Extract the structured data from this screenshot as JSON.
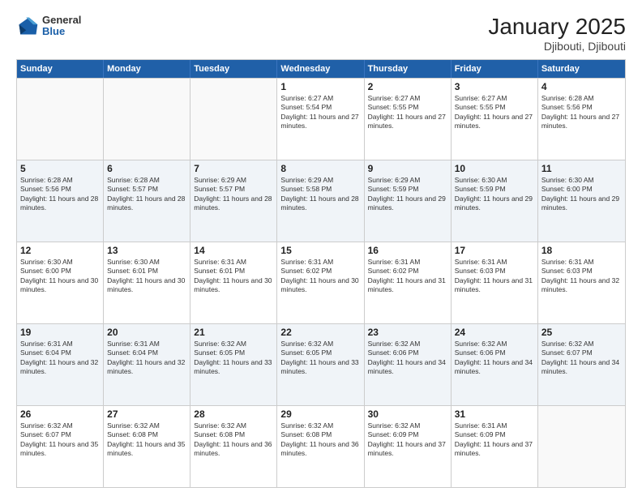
{
  "logo": {
    "general": "General",
    "blue": "Blue"
  },
  "header": {
    "title": "January 2025",
    "subtitle": "Djibouti, Djibouti"
  },
  "weekdays": [
    "Sunday",
    "Monday",
    "Tuesday",
    "Wednesday",
    "Thursday",
    "Friday",
    "Saturday"
  ],
  "weeks": [
    [
      {
        "day": "",
        "info": ""
      },
      {
        "day": "",
        "info": ""
      },
      {
        "day": "",
        "info": ""
      },
      {
        "day": "1",
        "info": "Sunrise: 6:27 AM\nSunset: 5:54 PM\nDaylight: 11 hours and 27 minutes."
      },
      {
        "day": "2",
        "info": "Sunrise: 6:27 AM\nSunset: 5:55 PM\nDaylight: 11 hours and 27 minutes."
      },
      {
        "day": "3",
        "info": "Sunrise: 6:27 AM\nSunset: 5:55 PM\nDaylight: 11 hours and 27 minutes."
      },
      {
        "day": "4",
        "info": "Sunrise: 6:28 AM\nSunset: 5:56 PM\nDaylight: 11 hours and 27 minutes."
      }
    ],
    [
      {
        "day": "5",
        "info": "Sunrise: 6:28 AM\nSunset: 5:56 PM\nDaylight: 11 hours and 28 minutes."
      },
      {
        "day": "6",
        "info": "Sunrise: 6:28 AM\nSunset: 5:57 PM\nDaylight: 11 hours and 28 minutes."
      },
      {
        "day": "7",
        "info": "Sunrise: 6:29 AM\nSunset: 5:57 PM\nDaylight: 11 hours and 28 minutes."
      },
      {
        "day": "8",
        "info": "Sunrise: 6:29 AM\nSunset: 5:58 PM\nDaylight: 11 hours and 28 minutes."
      },
      {
        "day": "9",
        "info": "Sunrise: 6:29 AM\nSunset: 5:59 PM\nDaylight: 11 hours and 29 minutes."
      },
      {
        "day": "10",
        "info": "Sunrise: 6:30 AM\nSunset: 5:59 PM\nDaylight: 11 hours and 29 minutes."
      },
      {
        "day": "11",
        "info": "Sunrise: 6:30 AM\nSunset: 6:00 PM\nDaylight: 11 hours and 29 minutes."
      }
    ],
    [
      {
        "day": "12",
        "info": "Sunrise: 6:30 AM\nSunset: 6:00 PM\nDaylight: 11 hours and 30 minutes."
      },
      {
        "day": "13",
        "info": "Sunrise: 6:30 AM\nSunset: 6:01 PM\nDaylight: 11 hours and 30 minutes."
      },
      {
        "day": "14",
        "info": "Sunrise: 6:31 AM\nSunset: 6:01 PM\nDaylight: 11 hours and 30 minutes."
      },
      {
        "day": "15",
        "info": "Sunrise: 6:31 AM\nSunset: 6:02 PM\nDaylight: 11 hours and 30 minutes."
      },
      {
        "day": "16",
        "info": "Sunrise: 6:31 AM\nSunset: 6:02 PM\nDaylight: 11 hours and 31 minutes."
      },
      {
        "day": "17",
        "info": "Sunrise: 6:31 AM\nSunset: 6:03 PM\nDaylight: 11 hours and 31 minutes."
      },
      {
        "day": "18",
        "info": "Sunrise: 6:31 AM\nSunset: 6:03 PM\nDaylight: 11 hours and 32 minutes."
      }
    ],
    [
      {
        "day": "19",
        "info": "Sunrise: 6:31 AM\nSunset: 6:04 PM\nDaylight: 11 hours and 32 minutes."
      },
      {
        "day": "20",
        "info": "Sunrise: 6:31 AM\nSunset: 6:04 PM\nDaylight: 11 hours and 32 minutes."
      },
      {
        "day": "21",
        "info": "Sunrise: 6:32 AM\nSunset: 6:05 PM\nDaylight: 11 hours and 33 minutes."
      },
      {
        "day": "22",
        "info": "Sunrise: 6:32 AM\nSunset: 6:05 PM\nDaylight: 11 hours and 33 minutes."
      },
      {
        "day": "23",
        "info": "Sunrise: 6:32 AM\nSunset: 6:06 PM\nDaylight: 11 hours and 34 minutes."
      },
      {
        "day": "24",
        "info": "Sunrise: 6:32 AM\nSunset: 6:06 PM\nDaylight: 11 hours and 34 minutes."
      },
      {
        "day": "25",
        "info": "Sunrise: 6:32 AM\nSunset: 6:07 PM\nDaylight: 11 hours and 34 minutes."
      }
    ],
    [
      {
        "day": "26",
        "info": "Sunrise: 6:32 AM\nSunset: 6:07 PM\nDaylight: 11 hours and 35 minutes."
      },
      {
        "day": "27",
        "info": "Sunrise: 6:32 AM\nSunset: 6:08 PM\nDaylight: 11 hours and 35 minutes."
      },
      {
        "day": "28",
        "info": "Sunrise: 6:32 AM\nSunset: 6:08 PM\nDaylight: 11 hours and 36 minutes."
      },
      {
        "day": "29",
        "info": "Sunrise: 6:32 AM\nSunset: 6:08 PM\nDaylight: 11 hours and 36 minutes."
      },
      {
        "day": "30",
        "info": "Sunrise: 6:32 AM\nSunset: 6:09 PM\nDaylight: 11 hours and 37 minutes."
      },
      {
        "day": "31",
        "info": "Sunrise: 6:31 AM\nSunset: 6:09 PM\nDaylight: 11 hours and 37 minutes."
      },
      {
        "day": "",
        "info": ""
      }
    ]
  ]
}
